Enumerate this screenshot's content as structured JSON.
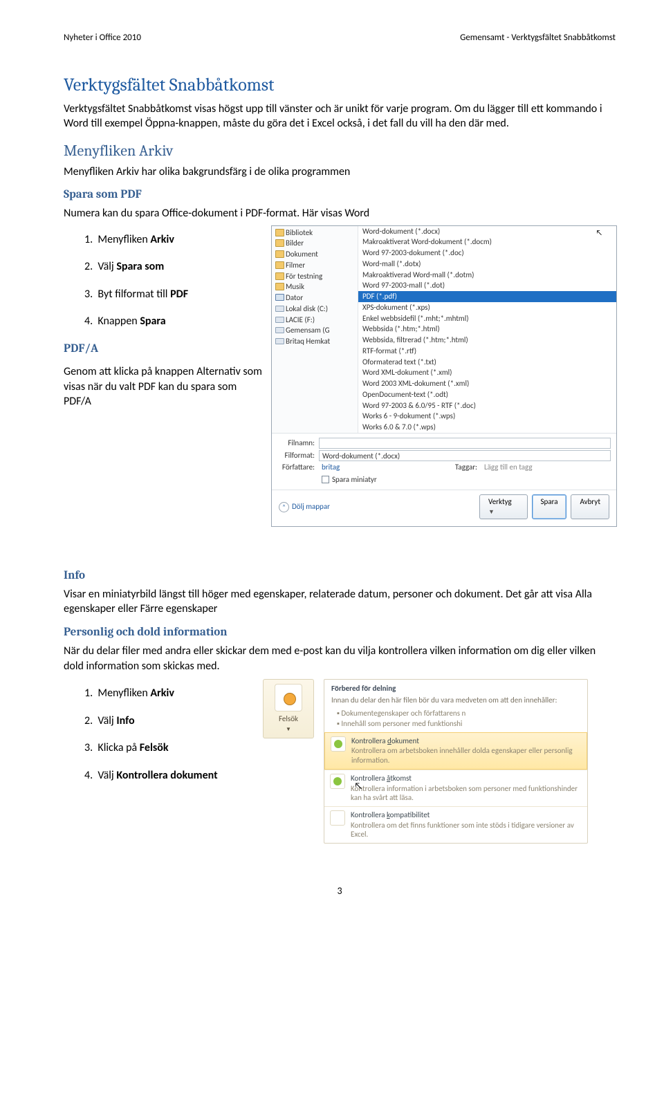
{
  "header": {
    "left": "Nyheter i Office 2010",
    "right": "Gemensamt - Verktygsfältet Snabbåtkomst"
  },
  "h1": "Verktygsfältet Snabbåtkomst",
  "p1": "Verktygsfältet Snabbåtkomst visas högst upp till vänster och är unikt för varje program. Om du lägger till ett kommando i Word till exempel Öppna-knappen, måste du göra det i Excel också, i det fall du vill ha den där med.",
  "h2": "Menyfliken Arkiv",
  "p2": "Menyfliken Arkiv har olika bakgrundsfärg i de olika programmen",
  "h3": "Spara som PDF",
  "p3": "Numera kan du spara Office-dokument i PDF-format. Här visas Word",
  "steps1": {
    "1": {
      "pre": "Menyfliken ",
      "b": "Arkiv"
    },
    "2": {
      "pre": "Välj ",
      "b": "Spara som"
    },
    "3": {
      "pre": "Byt filformat till ",
      "b": "PDF"
    },
    "4": {
      "pre": "Knappen ",
      "b": "Spara"
    }
  },
  "h4": "PDF/A",
  "p4": "Genom att klicka på knappen Alternativ som visas när du valt PDF kan du spara som PDF/A",
  "shot1": {
    "nav": [
      "Bibliotek",
      "Bilder",
      "Dokument",
      "Filmer",
      "För testning",
      "Musik",
      "Dator",
      "Lokal disk (C:)",
      "LACIE (F:)",
      "Gemensam (G",
      "Britaq Hemkat"
    ],
    "formats": [
      "Word-dokument (*.docx)",
      "Makroaktiverat Word-dokument (*.docm)",
      "Word 97-2003-dokument (*.doc)",
      "Word-mall (*.dotx)",
      "Makroaktiverad Word-mall (*.dotm)",
      "Word 97-2003-mall (*.dot)",
      "PDF (*.pdf)",
      "XPS-dokument (*.xps)",
      "Enkel webbsidefil (*.mht;*.mhtml)",
      "Webbsida (*.htm;*.html)",
      "Webbsida, filtrerad (*.htm;*.html)",
      "RTF-format (*.rtf)",
      "Oformaterad text (*.txt)",
      "Word XML-dokument (*.xml)",
      "Word 2003 XML-dokument (*.xml)",
      "OpenDocument-text (*.odt)",
      "Word 97-2003 & 6.0/95 - RTF (*.doc)",
      "Works 6 - 9-dokument (*.wps)",
      "Works 6.0 & 7.0 (*.wps)"
    ],
    "sel_index": 6,
    "filnamn_label": "Filnamn:",
    "filformat_label": "Filformat:",
    "filformat_value": "Word-dokument (*.docx)",
    "forfattare_label": "Författare:",
    "forfattare_value": "britag",
    "taggar_label": "Taggar:",
    "taggar_value": "Lägg till en tagg",
    "spara_miniatyr": "Spara miniatyr",
    "dolj": "Dölj mappar",
    "verktyg": "Verktyg",
    "spara": "Spara",
    "avbryt": "Avbryt"
  },
  "h5": "Info",
  "p5": "Visar en miniatyrbild längst till höger med egenskaper, relaterade datum, personer och dokument. Det går att visa Alla egenskaper eller Färre egenskaper",
  "h6": "Personlig och dold information",
  "p6": "När du delar filer med andra eller skickar dem med e-post kan du vilja kontrollera vilken information om dig eller vilken dold information som skickas med.",
  "steps2": {
    "1": {
      "pre": "Menyfliken ",
      "b": "Arkiv"
    },
    "2": {
      "pre": "Välj ",
      "b": "Info"
    },
    "3": {
      "pre": "Klicka på ",
      "b": "Felsök"
    },
    "4": {
      "pre": "Välj ",
      "b": "Kontrollera dokument"
    }
  },
  "shot2": {
    "button": "Felsök",
    "head_title": "Förbered för delning",
    "head_sub": "Innan du delar den här filen bör du vara medveten om att den innehåller:",
    "bullets": [
      "Dokumentegenskaper och författarens n",
      "Innehåll som personer med funktionshi"
    ],
    "items": [
      {
        "t_pre": "Kontrollera ",
        "t_u": "d",
        "t_post": "okument",
        "d": "Kontrollera om arbetsboken innehåller dolda egenskaper eller personlig information."
      },
      {
        "t_pre": "Kontrollera ",
        "t_u": "å",
        "t_post": "tkomst",
        "d": "Kontrollera information i arbetsboken som personer med funktionshinder kan ha svårt att läsa."
      },
      {
        "t_pre": "Kontrollera ",
        "t_u": "k",
        "t_post": "ompatibilitet",
        "d": "Kontrollera om det finns funktioner som inte stöds i tidigare versioner av Excel."
      }
    ]
  },
  "pagenum": "3"
}
